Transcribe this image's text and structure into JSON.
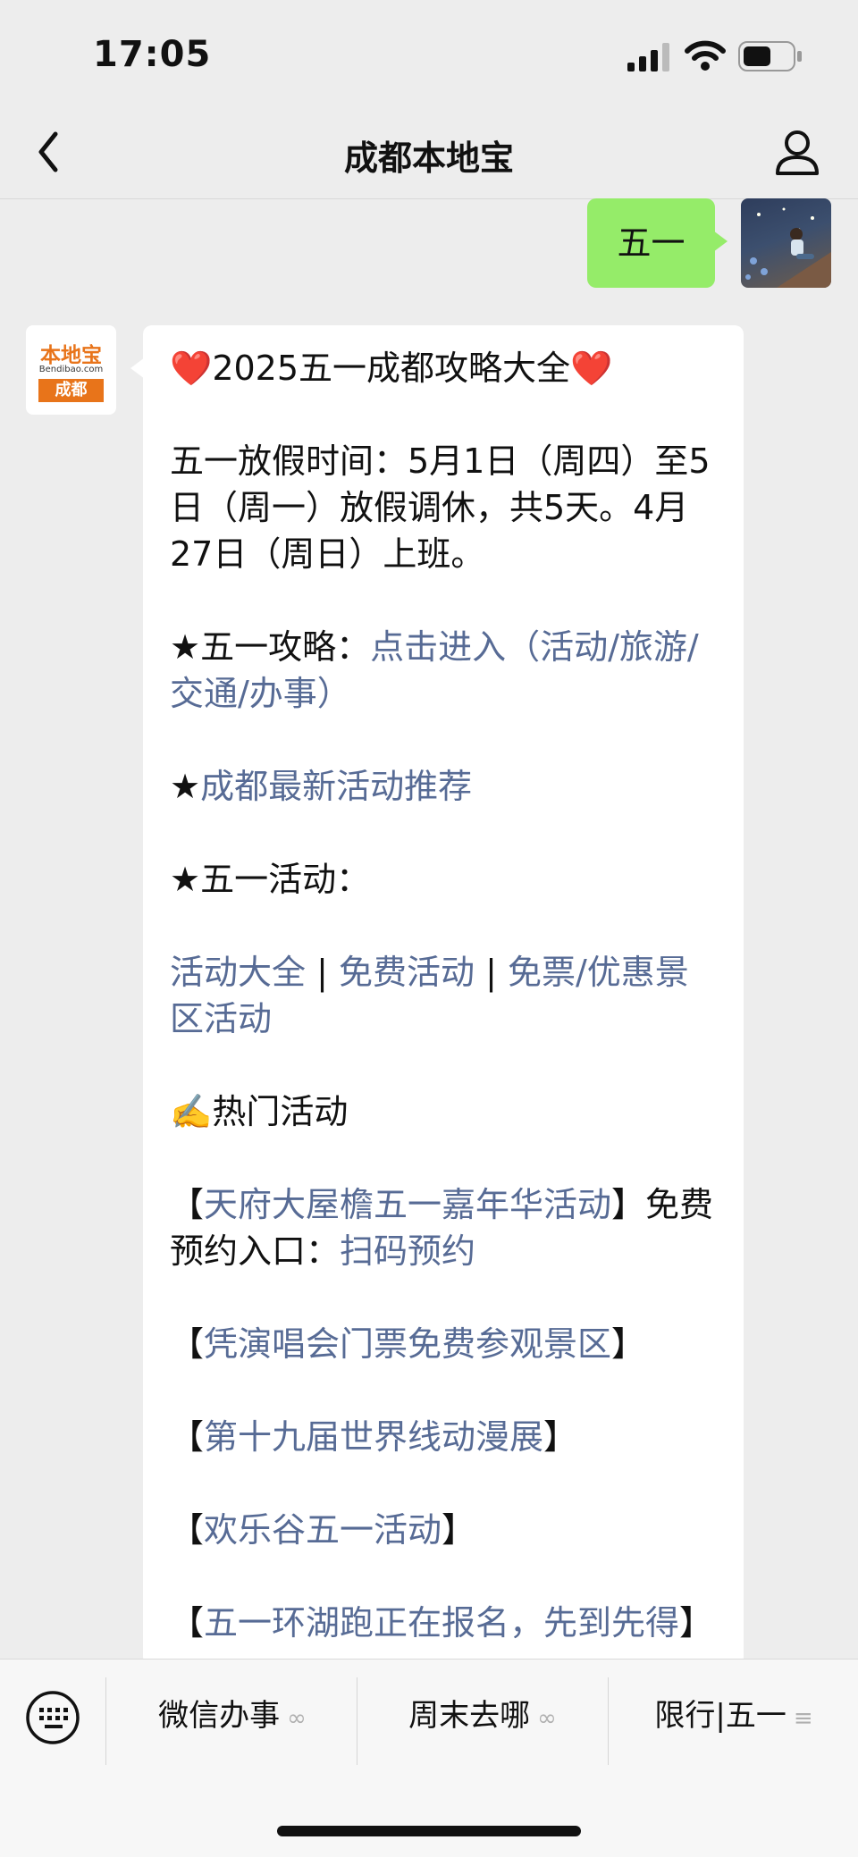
{
  "status_bar": {
    "time": "17:05"
  },
  "header": {
    "title": "成都本地宝"
  },
  "sent": {
    "text": "五一"
  },
  "bot": {
    "logo_main": "本地宝",
    "logo_site": "Bendibao.com",
    "logo_city": "成都"
  },
  "message": {
    "title_text": "2025五一成都攻略大全",
    "heart_glyph": "❤️",
    "holiday_text": "五一放假时间：5月1日（周四）至5日（周一）放假调休，共5天。4月27日（周日）上班。",
    "guide_label": "★五一攻略：",
    "guide_link": "点击进入（活动/旅游/交通/办事）",
    "star": "★",
    "recommend_link": "成都最新活动推荐",
    "activities_label": "★五一活动：",
    "activity_links": [
      "活动大全",
      "免费活动",
      "免票/优惠景区活动"
    ],
    "separator": " | ",
    "hot_label": "✍️热门活动",
    "item1_link": "天府大屋檐五一嘉年华活动",
    "item1_suffix": "免费预约入口：",
    "item1_action": "扫码预约",
    "bracket_open": "【",
    "bracket_close": "】",
    "item2_link": "凭演唱会门票免费参观景区",
    "item3_link": "第十九届世界线动漫展",
    "item4_link": "欢乐谷五一活动",
    "item5_link": "五一环湖跑正在报名，先到先得"
  },
  "bottom_menu": {
    "items": [
      {
        "label": "微信办事",
        "icon": "link-icon"
      },
      {
        "label": "周末去哪",
        "icon": "link-icon"
      },
      {
        "label": "限行|五一",
        "icon": "menu-lines-icon"
      }
    ]
  },
  "colors": {
    "bubble_sent": "#95ec69",
    "link": "#576b95",
    "background": "#ededed"
  }
}
